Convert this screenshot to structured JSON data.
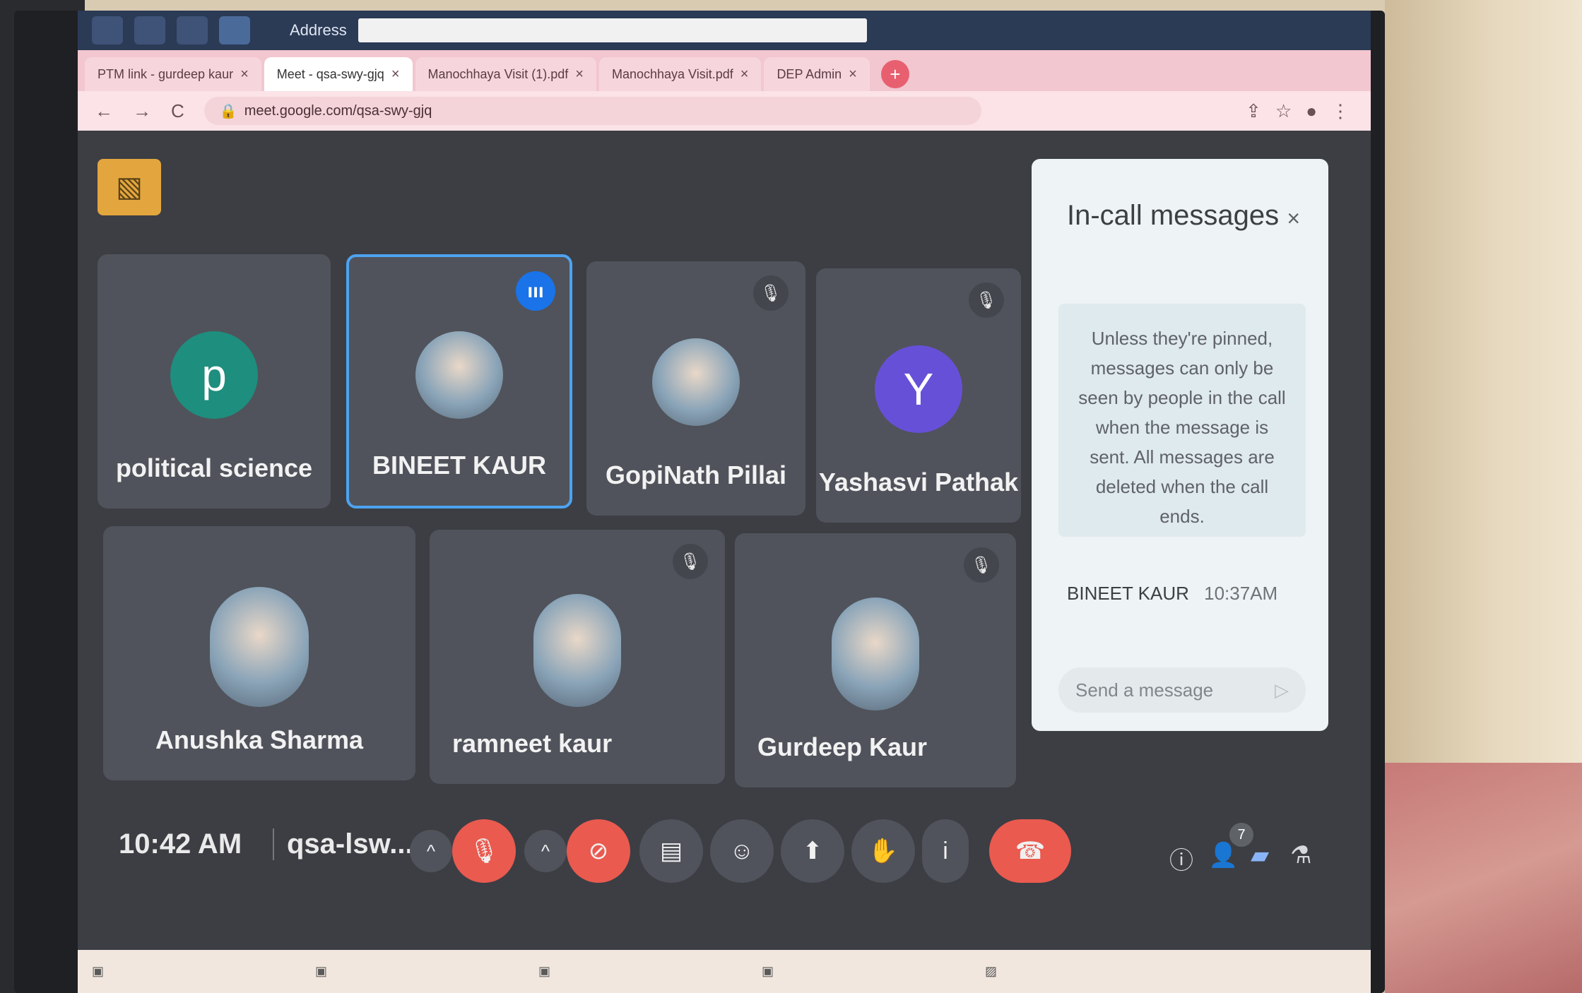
{
  "taskbar": {
    "address_label": "Address"
  },
  "tabs": [
    {
      "label": "PTM link - gurdeep kaur",
      "close": "×"
    },
    {
      "label": "Meet - qsa-swy-gjq",
      "close": "×"
    },
    {
      "label": "Manochhaya Visit (1).pdf",
      "close": "×"
    },
    {
      "label": "Manochhaya Visit.pdf",
      "close": "×"
    },
    {
      "label": "DEP Admin",
      "close": "×"
    }
  ],
  "new_tab": "+",
  "toolbar": {
    "back": "←",
    "forward": "→",
    "reload": "C",
    "url": "meet.google.com/qsa-swy-gjq"
  },
  "participants": [
    {
      "name": "political science",
      "initial": "p",
      "color": "#1e8e7e"
    },
    {
      "name": "BINEET KAUR",
      "speaking": "ııı"
    },
    {
      "name": "GopiNath Pillai"
    },
    {
      "name": "Yashasvi Pathak",
      "initial": "Y",
      "color": "#6750d8"
    },
    {
      "name": "Anushka Sharma"
    },
    {
      "name": "ramneet kaur"
    },
    {
      "name": "Gurdeep Kaur"
    }
  ],
  "chat": {
    "title": "In-call messages",
    "close": "×",
    "notice": "Unless they're pinned, messages can only be seen by people in the call when the message is sent. All messages are deleted when the call ends.",
    "sender": "BINEET KAUR",
    "time": "10:37AM",
    "placeholder": "Send a message",
    "send": "▷"
  },
  "meeting": {
    "time": "10:42 AM",
    "code": "qsa-lsw..."
  },
  "controls": {
    "chevron": "^",
    "info": "i",
    "badge_count": "7"
  },
  "colors": {
    "accent": "#1a73e8",
    "end_call": "#ea5a4f",
    "tile": "#50535b"
  }
}
